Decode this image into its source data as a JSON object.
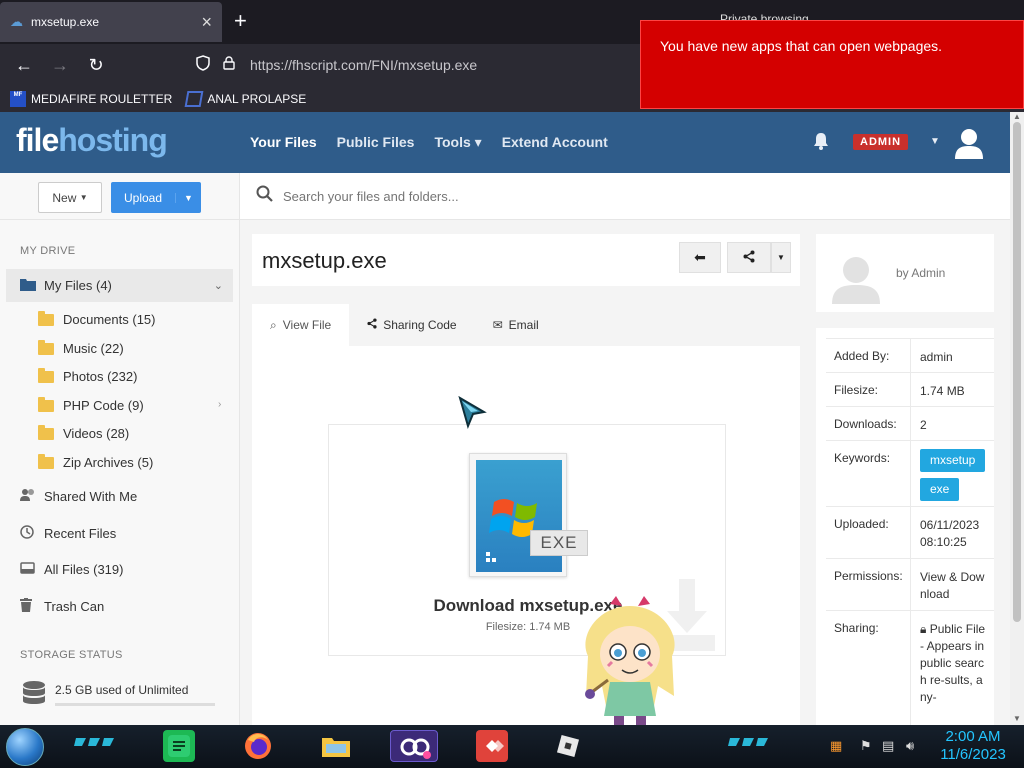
{
  "browser": {
    "tab_title": "mxsetup.exe",
    "tab_right_text": "Private browsing",
    "url": "https://fhscript.com/FNI/mxsetup.exe",
    "bookmarks": [
      {
        "label": "MEDIAFIRE ROULETTER",
        "icon_text": "MF"
      },
      {
        "label": "ANAL PROLAPSE"
      }
    ]
  },
  "notification": {
    "text": "You have new apps that can open webpages."
  },
  "header": {
    "logo_part1": "file",
    "logo_part2": "hosting",
    "nav": [
      "Your Files",
      "Public Files",
      "Tools ▾",
      "Extend Account"
    ],
    "admin_badge": "ADMIN"
  },
  "sidebar": {
    "new_label": "New",
    "upload_label": "Upload",
    "my_drive": "MY DRIVE",
    "my_files": "My Files (4)",
    "folders": [
      "Documents (15)",
      "Music (22)",
      "Photos (232)",
      "PHP Code (9)",
      "Videos (28)",
      "Zip Archives (5)"
    ],
    "links": [
      "Shared With Me",
      "Recent Files",
      "All Files (319)",
      "Trash Can"
    ],
    "storage_heading": "STORAGE STATUS",
    "storage_text": "2.5 GB used of Unlimited",
    "storage_fraction": 0
  },
  "search": {
    "placeholder": "Search your files and folders..."
  },
  "file": {
    "title": "mxsetup.exe",
    "tabs": [
      "View File",
      "Sharing Code",
      "Email"
    ],
    "exe_tag": "EXE",
    "download_label": "Download mxsetup.exe",
    "filesize_line": "Filesize: 1.74 MB"
  },
  "uploader": {
    "by": "by Admin"
  },
  "details": {
    "added_by_k": "Added By:",
    "added_by_v": "admin",
    "filesize_k": "Filesize:",
    "filesize_v": "1.74 MB",
    "downloads_k": "Downloads:",
    "downloads_v": "2",
    "keywords_k": "Keywords:",
    "keywords": [
      "mxsetup",
      "exe"
    ],
    "uploaded_k": "Uploaded:",
    "uploaded_v": "06/11/2023 08:10:25",
    "permissions_k": "Permissions:",
    "permissions_v": "View & Download",
    "sharing_k": "Sharing:",
    "sharing_v": "Public File - Appears in public search re-sults, any-"
  },
  "taskbar": {
    "time": "2:00 AM",
    "date": "11/6/2023"
  },
  "colors": {
    "header": "#2f5c8a",
    "upload": "#3a8ee6",
    "notification": "#d40000",
    "admin_badge": "#c9302c",
    "keyword": "#22a7e0"
  }
}
